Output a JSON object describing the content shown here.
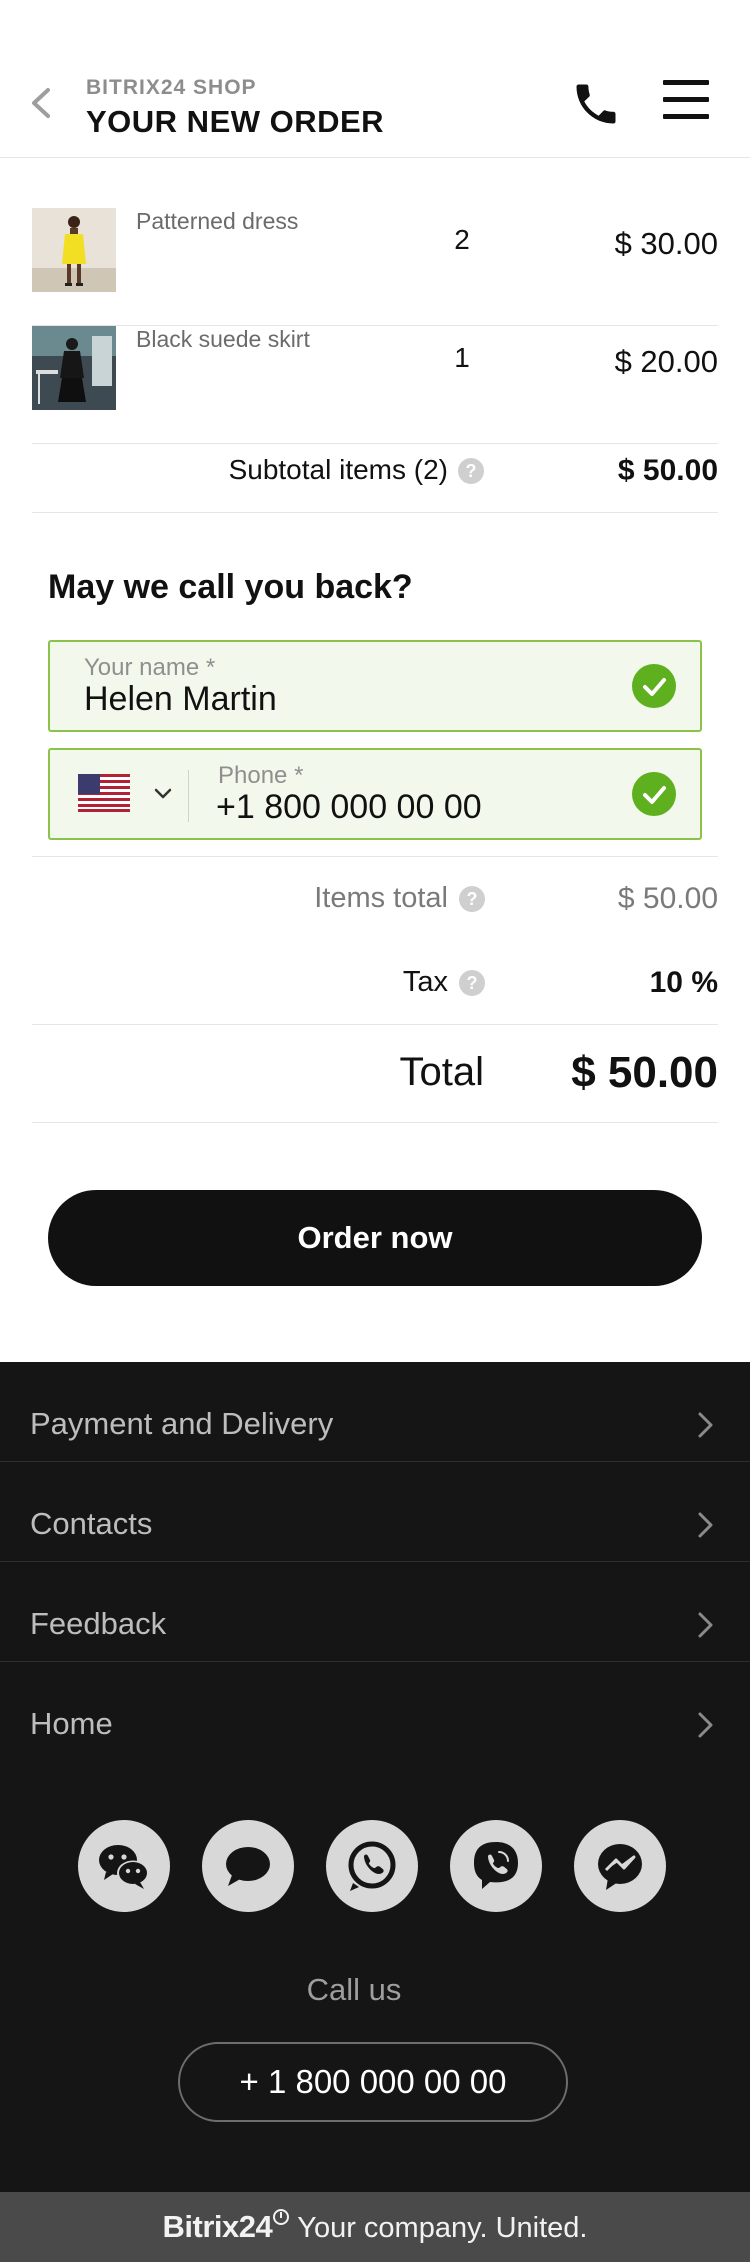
{
  "header": {
    "shop_name": "BITRIX24 SHOP",
    "title": "YOUR NEW ORDER",
    "back_icon": "chevron-left-icon",
    "phone_icon": "phone-icon",
    "menu_icon": "hamburger-menu-icon"
  },
  "cart": {
    "items": [
      {
        "name": "Patterned dress",
        "quantity": "2",
        "price": "$ 30.00"
      },
      {
        "name": "Black suede skirt",
        "quantity": "1",
        "price": "$ 20.00"
      }
    ],
    "subtotal_label": "Subtotal items (2)",
    "subtotal_value": "$ 50.00"
  },
  "callback": {
    "title": "May we call you back?",
    "name_label": "Your name *",
    "name_value": "Helen Martin",
    "phone_label": "Phone *",
    "phone_value": "+1 800 000 00 00",
    "country": "US"
  },
  "totals": {
    "items_total_label": "Items total",
    "items_total_value": "$ 50.00",
    "tax_label": "Tax",
    "tax_value": "10 %",
    "total_label": "Total",
    "total_value": "$ 50.00"
  },
  "order_button": "Order now",
  "footer": {
    "nav": [
      "Payment and Delivery",
      "Contacts",
      "Feedback",
      "Home"
    ],
    "social_icons": [
      "wechat-icon",
      "chat-bubble-icon",
      "whatsapp-icon",
      "viber-icon",
      "messenger-icon"
    ],
    "call_us": "Call us",
    "phone": "+ 1 800 000 00 00"
  },
  "bottom_bar": {
    "brand": "Bitrix24",
    "tagline": "Your company. United."
  },
  "colors": {
    "accent_green": "#5eb01e",
    "field_border": "#8bc34a",
    "footer_bg": "#151515",
    "bottom_bar_bg": "#4a4a4a"
  }
}
